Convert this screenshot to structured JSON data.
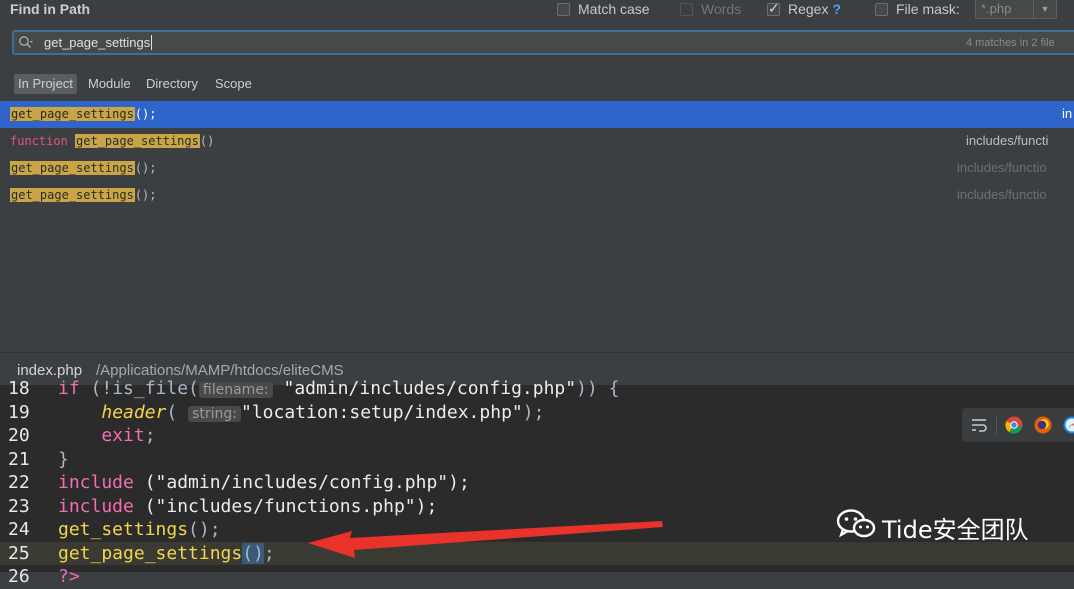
{
  "dialog": {
    "title": "Find in Path",
    "options": {
      "match_case": {
        "label": "Match case",
        "checked": false
      },
      "words": {
        "label": "Words",
        "checked": false,
        "enabled": false
      },
      "regex": {
        "label": "Regex",
        "checked": true,
        "help": "?"
      },
      "file_mask": {
        "label": "File mask:",
        "checked": false,
        "value": "*.php"
      }
    },
    "search": {
      "query": "get_page_settings",
      "match_count": "4 matches in 2 file"
    },
    "scopes": [
      {
        "label": "In Project",
        "selected": true
      },
      {
        "label": "Module",
        "selected": false
      },
      {
        "label": "Directory",
        "selected": false
      },
      {
        "label": "Scope",
        "selected": false
      }
    ],
    "results": [
      {
        "prefix": "",
        "match": "get_page_settings",
        "suffix": "();",
        "file": "in",
        "selected": true
      },
      {
        "prefix": "function ",
        "match": "get_page_settings",
        "suffix": "()",
        "file": "includes/functi",
        "selected": false
      },
      {
        "prefix": "",
        "match": "get_page_settings",
        "suffix": "();",
        "file": "includes/functio",
        "selected": false
      },
      {
        "prefix": "",
        "match": "get_page_settings",
        "suffix": "();",
        "file": "includes/functio",
        "selected": false
      }
    ]
  },
  "preview": {
    "file_name": "index.php",
    "file_path": "/Applications/MAMP/htdocs/eliteCMS"
  },
  "editor": {
    "line_numbers": [
      "18",
      "19",
      "20",
      "21",
      "22",
      "23",
      "24",
      "25",
      "26"
    ],
    "lines": {
      "l18_kw": "if",
      "l18_rest": " (!is_file(",
      "l18_hint": "filename:",
      "l18_str": " \"admin/includes/config.php\"",
      "l18_end": ")) {",
      "l19_fn": "header",
      "l19_open": "(",
      "l19_hint": "string:",
      "l19_str": "\"location:setup/index.php\"",
      "l19_end": ");",
      "l20_kw": "exit",
      "l20_end": ";",
      "l21": "}",
      "l22_kw": "include",
      "l22_str": " (\"admin/includes/config.php\");",
      "l23_kw": "include",
      "l23_str": " (\"includes/functions.php\");",
      "l24_fn": "get_settings",
      "l24_end": "();",
      "l25_fn": "get_page_settings",
      "l25_paren": "()",
      "l25_end": ";",
      "l26": "?>"
    }
  },
  "watermark": {
    "text": "Tide安全团队"
  },
  "colors": {
    "selection": "#2f65ca",
    "match_highlight": "#c9a546",
    "arrow": "#e8322a",
    "keyword": "#f46cb1",
    "function": "#f2d54d"
  }
}
